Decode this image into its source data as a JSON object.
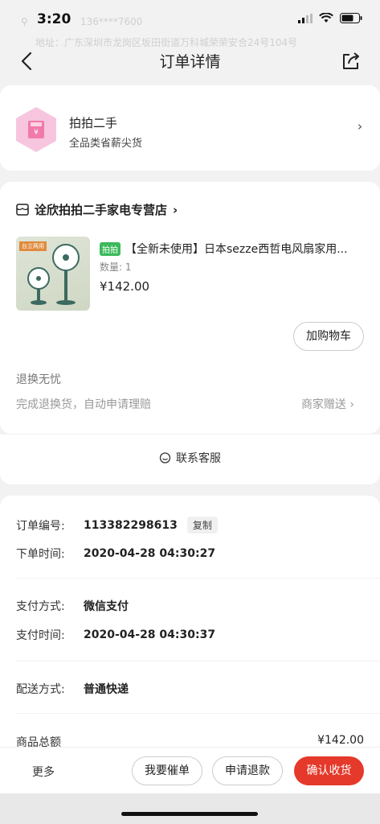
{
  "status_bar": {
    "time": "3:20",
    "ghost_phone": "136****7600",
    "ghost_address": "地址：广东深圳市龙岗区坂田街道万科城荣荣安合24号104号"
  },
  "nav": {
    "title": "订单详情"
  },
  "promo": {
    "title": "拍拍二手",
    "subtitle": "全品类省薪尖货",
    "chevron": "›"
  },
  "shop": {
    "name": "诠欣拍拍二手家电专营店",
    "chevron": "›",
    "product": {
      "image_text": "台立两用",
      "tag": "拍拍",
      "title": "【全新未使用】日本sezze西哲电风扇家用...",
      "qty": "数量: 1",
      "price": "¥142.00"
    },
    "add_cart": "加购物车",
    "return_title": "退换无忧",
    "return_desc": "完成退换货，自动申请理赔",
    "return_right": "商家赠送 ›"
  },
  "service": {
    "label": "联系客服"
  },
  "order_info": {
    "order_no_label": "订单编号:",
    "order_no": "113382298613",
    "copy_label": "复制",
    "order_time_label": "下单时间:",
    "order_time": "2020-04-28 04:30:27",
    "pay_method_label": "支付方式:",
    "pay_method": "微信支付",
    "pay_time_label": "支付时间:",
    "pay_time": "2020-04-28 04:30:37",
    "delivery_label": "配送方式:",
    "delivery": "普通快递",
    "total_label": "商品总额",
    "total": "¥142.00"
  },
  "bottom_bar": {
    "more": "更多",
    "urge": "我要催单",
    "refund": "申请退款",
    "confirm": "确认收货"
  },
  "colors": {
    "accent": "#e4392b",
    "tag_green": "#3cb95c"
  }
}
